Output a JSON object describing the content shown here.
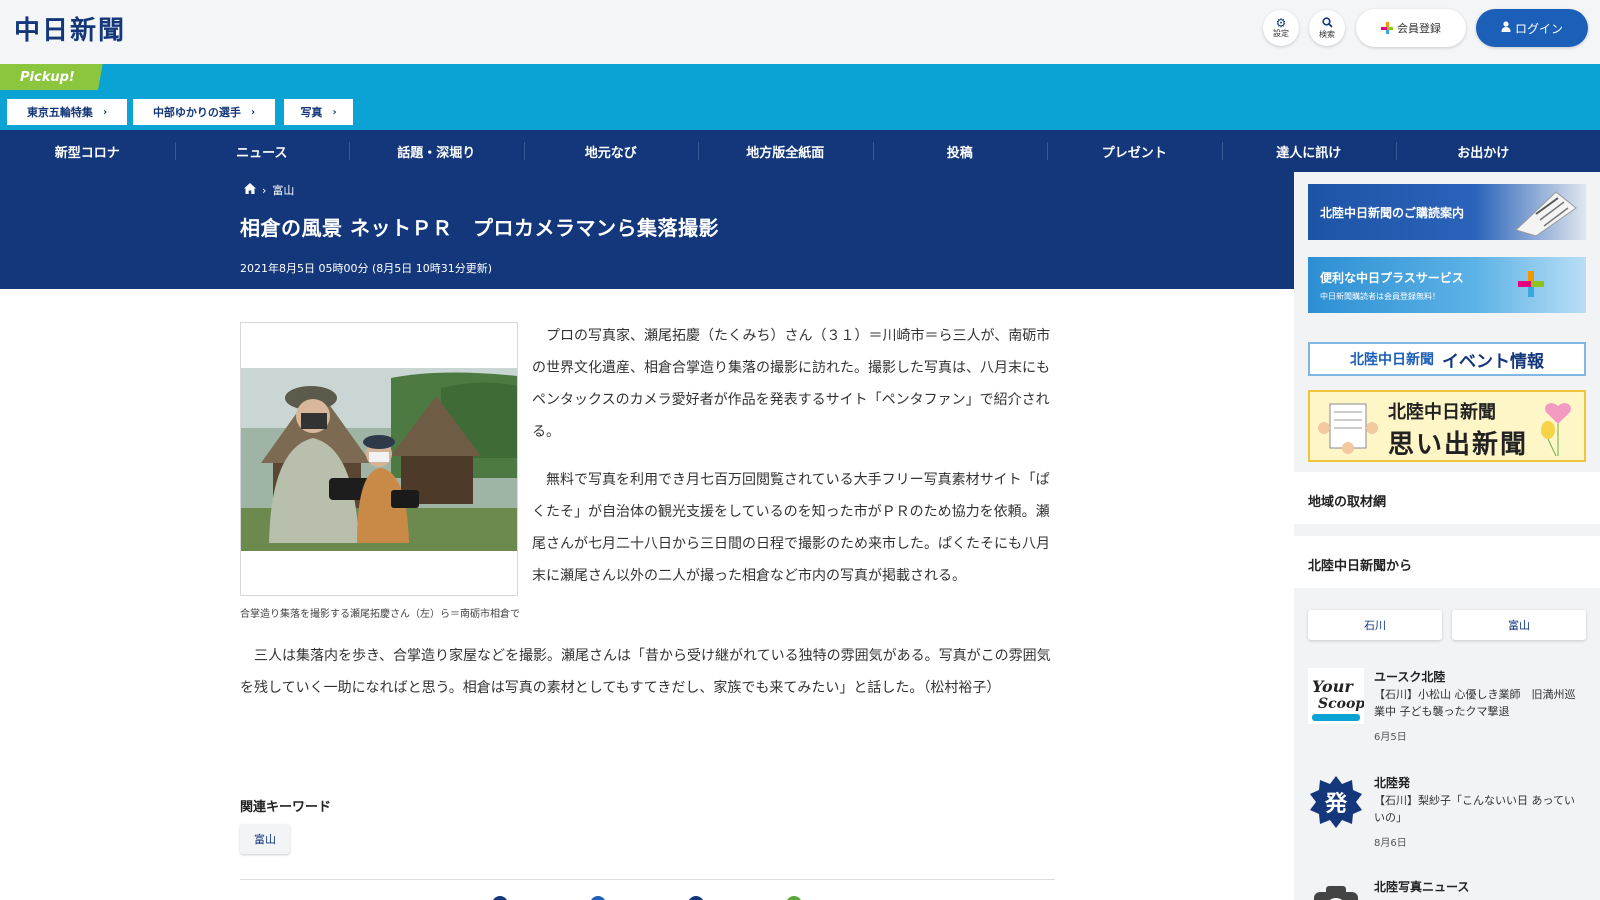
{
  "header": {
    "logo": "中日新聞",
    "settings_label": "設定",
    "search_label": "検索",
    "register_label": "会員登録",
    "login_label": "ログイン"
  },
  "pickup": {
    "label": "Pickup!",
    "tags": [
      "東京五輪特集",
      "中部ゆかりの選手",
      "写真"
    ]
  },
  "nav": {
    "items": [
      "新型コロナ",
      "ニュース",
      "話題・深堀り",
      "地元なび",
      "地方版全紙面",
      "投稿",
      "プレゼント",
      "達人に訊け",
      "お出かけ"
    ]
  },
  "article": {
    "breadcrumb": "富山",
    "title": "相倉の風景 ネットＰＲ　プロカメラマンら集落撮影",
    "date": "2021年8月5日 05時00分 (8月5日 10時31分更新)",
    "caption": "合掌造り集落を撮影する瀬尾拓慶さん（左）ら＝南砺市相倉で",
    "para1": "プロの写真家、瀬尾拓慶（たくみち）さん（３１）＝川崎市＝ら三人が、南砺市の世界文化遺産、相倉合掌造り集落の撮影に訪れた。撮影した写真は、八月末にもペンタックスのカメラ愛好者が作品を発表するサイト「ペンタファン」で紹介される。",
    "para2": "無料で写真を利用でき月七百万回閲覧されている大手フリー写真素材サイト「ぱくたそ」が自治体の観光支援をしているのを知った市がＰＲのため協力を依頼。瀬尾さんが七月二十八日から三日間の日程で撮影のため来市した。ぱくたそにも八月末に瀬尾さん以外の二人が撮った相倉など市内の写真が掲載される。",
    "para3": "三人は集落内を歩き、合掌造り家屋などを撮影。瀬尾さんは「昔から受け継がれている独特の雰囲気がある。写真がこの雰囲気を残していく一助になればと思う。相倉は写真の素材としてもすてきだし、家族でも来てみたい」と話した。（松村裕子）",
    "keywords_title": "関連キーワード",
    "keyword": "富山"
  },
  "sidebar": {
    "banner1": "北陸中日新聞のご購読案内",
    "banner2": "便利な中日プラスサービス",
    "banner2_sub": "中日新聞購読者は会員登録無料！",
    "banner3_a": "北陸中日新聞",
    "banner3_b": "イベント情報",
    "banner4_line1": "北陸中日新聞",
    "banner4_line2": "思い出新聞",
    "section1": "地域の取材網",
    "section2": "北陸中日新聞から",
    "tabs": [
      "石川",
      "富山"
    ],
    "feed": [
      {
        "title": "ユースク北陸",
        "text": "【石川】小松山 心優しき業師　旧満州巡業中 子ども襲ったクマ撃退",
        "date": "6月5日"
      },
      {
        "title": "北陸発",
        "text": "【石川】梨紗子「こんないい日 あっていいの」",
        "date": "8月6日"
      },
      {
        "title": "北陸写真ニュース",
        "text": "",
        "date": ""
      }
    ]
  },
  "colors": {
    "navy": "#13377a",
    "pickup_blue": "#0ba2d4",
    "pickup_green": "#8cc63f",
    "login_blue": "#1c5fb8"
  }
}
